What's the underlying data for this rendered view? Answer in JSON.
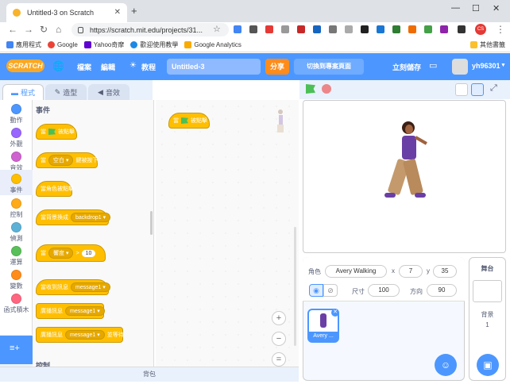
{
  "browser": {
    "tab_title": "Untitled-3 on Scratch",
    "url": "https://scratch.mit.edu/projects/31...",
    "bookmarks": [
      "應用程式",
      "Google",
      "Yahoo奇摩",
      "歡迎使用教學",
      "Google Analytics"
    ],
    "other_bookmarks": "其他書籤"
  },
  "menubar": {
    "logo": "SCRATCH",
    "file": "檔案",
    "edit": "編輯",
    "tutorials": "教程",
    "project_title": "Untitled-3",
    "share": "分享",
    "see_project": "切換到專案頁面",
    "save_now": "立刻儲存",
    "username": "yh96301"
  },
  "tabs": {
    "code": "程式",
    "costumes": "造型",
    "sounds": "音效"
  },
  "categories": [
    {
      "label": "動作",
      "color": "#4c97ff"
    },
    {
      "label": "外觀",
      "color": "#9966ff"
    },
    {
      "label": "音效",
      "color": "#cf63cf"
    },
    {
      "label": "事件",
      "color": "#ffbf00"
    },
    {
      "label": "控制",
      "color": "#ffab19"
    },
    {
      "label": "偵測",
      "color": "#5cb1d6"
    },
    {
      "label": "運算",
      "color": "#59c059"
    },
    {
      "label": "變數",
      "color": "#ff8c1a"
    },
    {
      "label": "函式積木",
      "color": "#ff6680"
    }
  ],
  "palette": {
    "header": "事件",
    "b1_pre": "當",
    "b1_post": "被點擊",
    "b2_pre": "當",
    "b2_drop": "空白",
    "b2_post": "鍵被按下",
    "b3": "當角色被點擊",
    "b4_pre": "當背景換成",
    "b4_drop": "backdrop1",
    "b5_pre": "當",
    "b5_drop": "響度",
    "b5_val": "10",
    "b6_pre": "當收到訊息",
    "b6_drop": "message1",
    "b7_pre": "廣播訊息",
    "b7_drop": "message1",
    "b8_pre": "廣播訊息",
    "b8_drop": "message1",
    "b8_post": "並等待",
    "footer": "控制"
  },
  "script": {
    "b_pre": "當",
    "b_post": "被點擊"
  },
  "backpack": "背包",
  "sprite": {
    "label": "角色",
    "name": "Avery Walking",
    "x": "7",
    "y": "35",
    "size_label": "尺寸",
    "size": "100",
    "direction_label": "方向",
    "direction": "90",
    "thumb_name": "Avery ..."
  },
  "stage_pane": {
    "title": "舞台",
    "backdrops_label": "背景",
    "backdrops_count": "1"
  }
}
